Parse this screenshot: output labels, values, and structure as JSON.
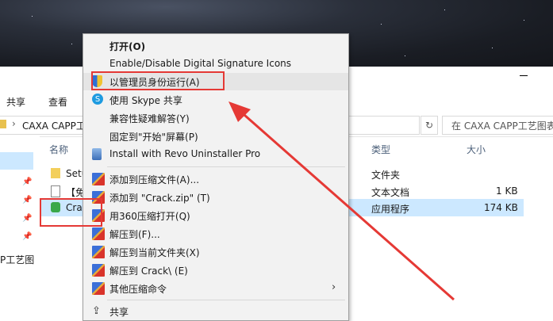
{
  "ribbon": {
    "tabs": [
      "共享",
      "查看"
    ]
  },
  "address": {
    "path": "CAXA CAPP工",
    "search_placeholder": "在 CAXA CAPP工艺图表"
  },
  "nav": {
    "partial_label": "P工艺图"
  },
  "columns": {
    "name": "名称",
    "type": "类型",
    "size": "大小"
  },
  "files": [
    {
      "name": "Setu",
      "type": "文件夹",
      "size": ""
    },
    {
      "name": "【免",
      "type": "文本文档",
      "size": "1 KB"
    },
    {
      "name": "Cra",
      "type": "应用程序",
      "size": "174 KB"
    }
  ],
  "context_menu": {
    "items": [
      {
        "label": "打开(O)",
        "icon": "none"
      },
      {
        "label": "Enable/Disable Digital Signature Icons",
        "icon": "none"
      },
      {
        "label": "以管理员身份运行(A)",
        "icon": "uac-shield-icon"
      },
      {
        "label": "使用 Skype 共享",
        "icon": "skype-icon"
      },
      {
        "label": "兼容性疑难解答(Y)",
        "icon": "none"
      },
      {
        "label": "固定到\"开始\"屏幕(P)",
        "icon": "none"
      },
      {
        "label": "Install with Revo Uninstaller Pro",
        "icon": "revo-uninstaller-icon"
      },
      {
        "label": "添加到压缩文件(A)...",
        "icon": "archive-icon"
      },
      {
        "label": "添加到 \"Crack.zip\" (T)",
        "icon": "archive-icon"
      },
      {
        "label": "用360压缩打开(Q)",
        "icon": "archive-icon"
      },
      {
        "label": "解压到(F)...",
        "icon": "archive-icon"
      },
      {
        "label": "解压到当前文件夹(X)",
        "icon": "archive-icon"
      },
      {
        "label": "解压到 Crack\\ (E)",
        "icon": "archive-icon"
      },
      {
        "label": "其他压缩命令",
        "icon": "archive-icon"
      },
      {
        "label": "共享",
        "icon": "share-icon"
      }
    ]
  },
  "colors": {
    "annotation_red": "#e53935",
    "selection_blue": "#cce8ff",
    "menu_bg": "#f2f2f2"
  }
}
